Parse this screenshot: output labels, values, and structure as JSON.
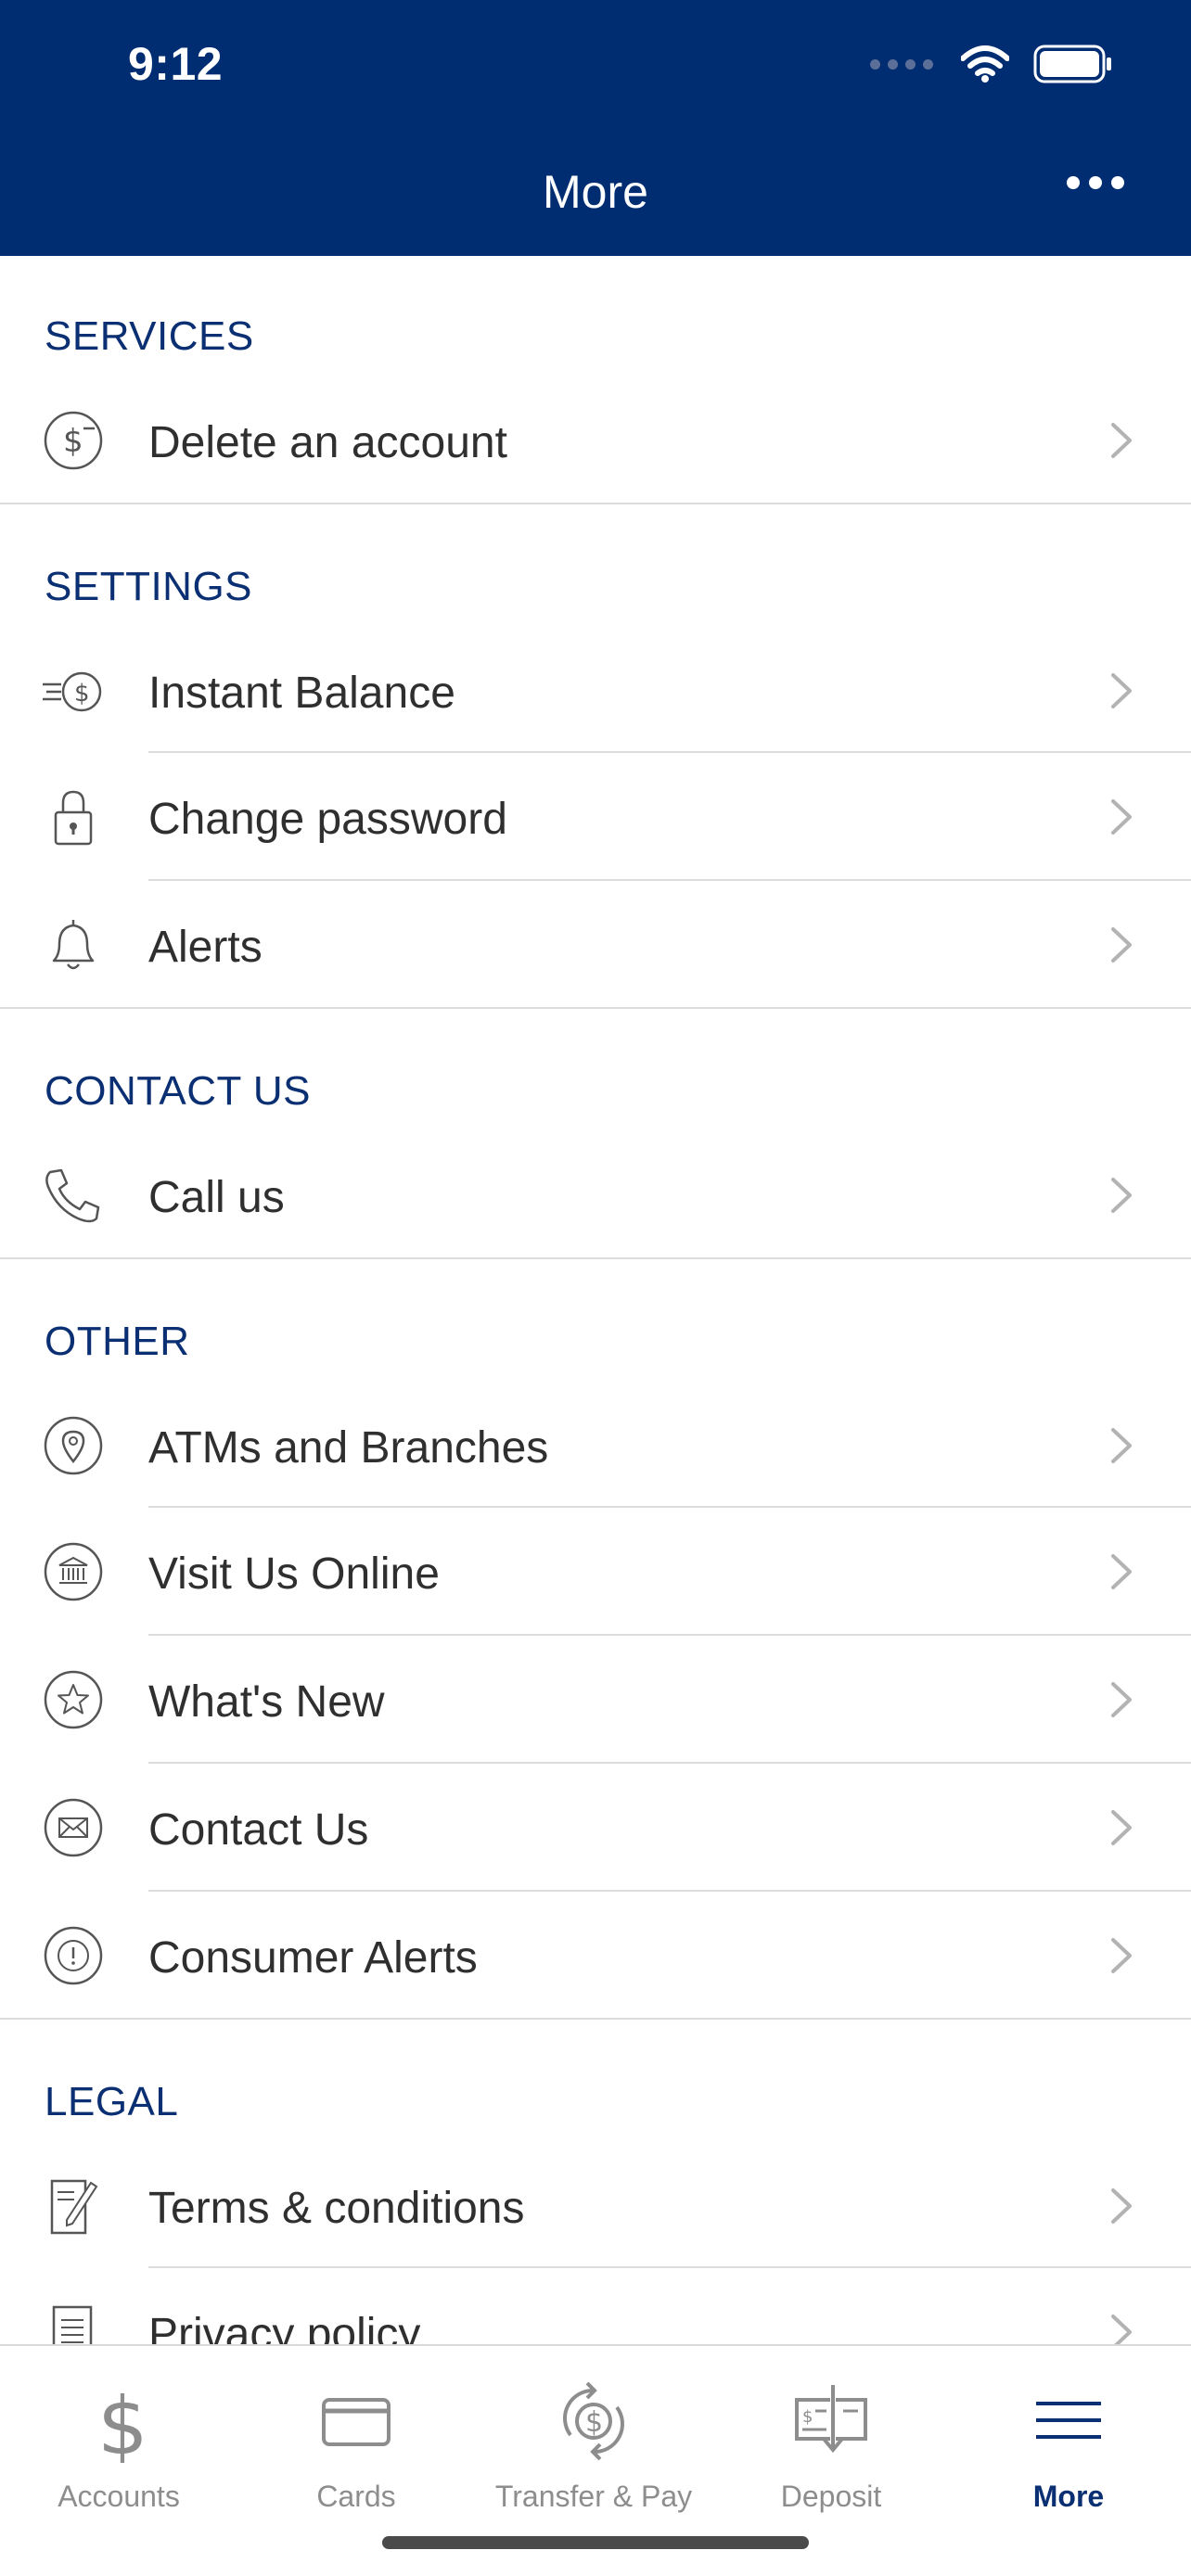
{
  "status_bar": {
    "time": "9:12"
  },
  "header": {
    "title": "More"
  },
  "sections": {
    "services": {
      "title": "SERVICES",
      "items": [
        {
          "label": "Delete an account",
          "icon": "dollar-minus-icon"
        }
      ]
    },
    "settings": {
      "title": "SETTINGS",
      "items": [
        {
          "label": "Instant Balance",
          "icon": "instant-balance-icon"
        },
        {
          "label": "Change password",
          "icon": "lock-icon"
        },
        {
          "label": "Alerts",
          "icon": "bell-icon"
        }
      ]
    },
    "contact": {
      "title": "CONTACT US",
      "items": [
        {
          "label": "Call us",
          "icon": "phone-icon"
        }
      ]
    },
    "other": {
      "title": "OTHER",
      "items": [
        {
          "label": "ATMs and Branches",
          "icon": "location-pin-icon"
        },
        {
          "label": "Visit Us Online",
          "icon": "bank-icon"
        },
        {
          "label": "What's New",
          "icon": "star-icon"
        },
        {
          "label": "Contact Us",
          "icon": "envelope-icon"
        },
        {
          "label": "Consumer Alerts",
          "icon": "exclamation-icon"
        }
      ]
    },
    "legal": {
      "title": "LEGAL",
      "items": [
        {
          "label": "Terms & conditions",
          "icon": "document-pen-icon"
        },
        {
          "label": "Privacy policy",
          "icon": "document-list-icon"
        }
      ]
    }
  },
  "tabbar": {
    "items": [
      {
        "label": "Accounts",
        "icon": "dollar-icon"
      },
      {
        "label": "Cards",
        "icon": "card-icon"
      },
      {
        "label": "Transfer & Pay",
        "icon": "transfer-icon"
      },
      {
        "label": "Deposit",
        "icon": "check-deposit-icon"
      },
      {
        "label": "More",
        "icon": "menu-icon"
      }
    ],
    "active": "More"
  },
  "colors": {
    "brand": "#002d72",
    "section_title": "#0b2f73",
    "text": "#2f2f2f",
    "inactive_tab": "#8d8d8d"
  }
}
